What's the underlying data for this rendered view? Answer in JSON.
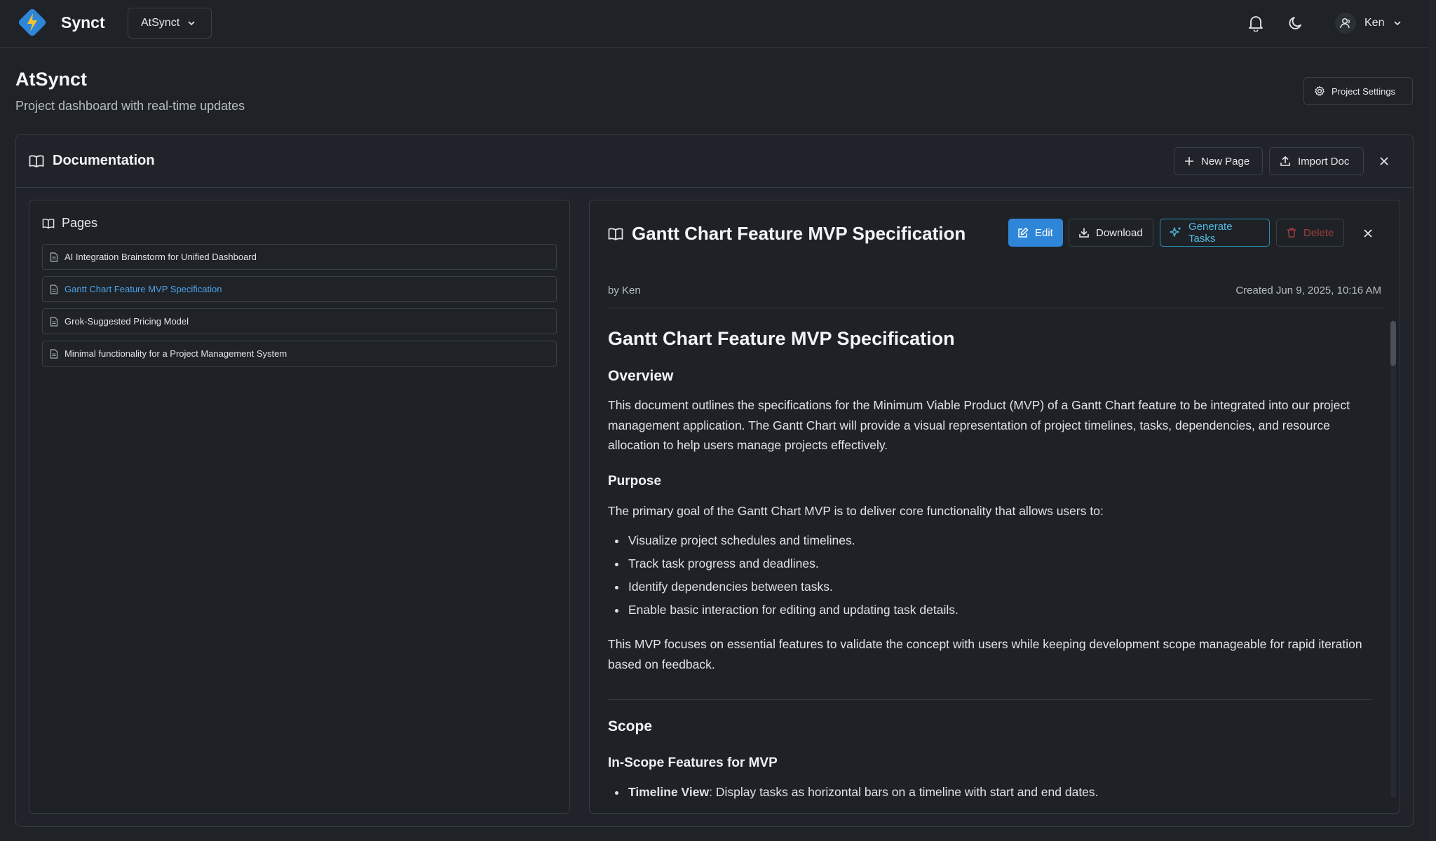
{
  "app": {
    "brand": "Synct",
    "project_selector": "AtSynct",
    "user_name": "Ken"
  },
  "page": {
    "title": "AtSynct",
    "subtitle": "Project dashboard with real-time updates",
    "settings_label": "Project Settings"
  },
  "documentation": {
    "title": "Documentation",
    "new_page_label": "New Page",
    "import_label": "Import Doc"
  },
  "pages": {
    "title": "Pages",
    "items": [
      {
        "label": "AI Integration Brainstorm for Unified Dashboard",
        "active": false
      },
      {
        "label": "Gantt Chart Feature MVP Specification",
        "active": true
      },
      {
        "label": "Grok-Suggested Pricing Model",
        "active": false
      },
      {
        "label": "Minimal functionality for a Project Management System",
        "active": false
      }
    ]
  },
  "viewer": {
    "title": "Gantt Chart Feature MVP Specification",
    "edit_label": "Edit",
    "download_label": "Download",
    "generate_label": "Generate Tasks",
    "delete_label": "Delete",
    "author": "by Ken",
    "created": "Created Jun 9, 2025, 10:16 AM",
    "doc": {
      "h1": "Gantt Chart Feature MVP Specification",
      "overview_heading": "Overview",
      "overview_text": "This document outlines the specifications for the Minimum Viable Product (MVP) of a Gantt Chart feature to be integrated into our project management application. The Gantt Chart will provide a visual representation of project timelines, tasks, dependencies, and resource allocation to help users manage projects effectively.",
      "purpose_heading": "Purpose",
      "purpose_intro": "The primary goal of the Gantt Chart MVP is to deliver core functionality that allows users to:",
      "purpose_items": [
        "Visualize project schedules and timelines.",
        "Track task progress and deadlines.",
        "Identify dependencies between tasks.",
        "Enable basic interaction for editing and updating task details."
      ],
      "purpose_outro": "This MVP focuses on essential features to validate the concept with users while keeping development scope manageable for rapid iteration based on feedback.",
      "scope_heading": "Scope",
      "inscope_heading": "In-Scope Features for MVP",
      "inscope_first_bold": "Timeline View",
      "inscope_first_rest": ": Display tasks as horizontal bars on a timeline with start and end dates."
    }
  },
  "colors": {
    "background": "#1f2328",
    "accent": "#2f86d8",
    "active_link": "#4ea1e8",
    "generate": "#55b9e2",
    "danger": "#a33b3b"
  }
}
